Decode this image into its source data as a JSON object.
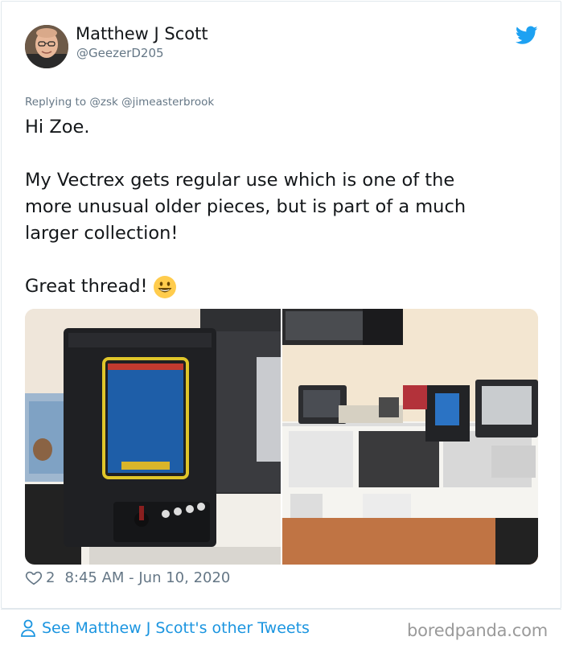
{
  "tweet": {
    "author_name": "Matthew J Scott",
    "author_handle": "@GeezerD205",
    "replying_to": "Replying to @zsk @jimeasterbrook",
    "lines": {
      "greeting": "Hi Zoe.",
      "p1_l1": "My Vectrex gets regular use which is one of the",
      "p1_l2": "more unusual older pieces, but is part of a much",
      "p1_l3": "larger collection!",
      "closing": "Great thread!"
    },
    "likes": "2",
    "timestamp": "8:45 AM - Jun 10, 2020"
  },
  "footer": {
    "see_more": "See Matthew J Scott's other Tweets",
    "watermark": "boredpanda.com"
  },
  "icons": {
    "bird": "twitter-bird-icon",
    "heart": "heart-icon",
    "person": "person-icon",
    "emoji": "grinning-face-emoji"
  },
  "colors": {
    "accent": "#1da1f2",
    "link": "#1b95e0",
    "muted": "#657786",
    "text": "#14171a"
  }
}
